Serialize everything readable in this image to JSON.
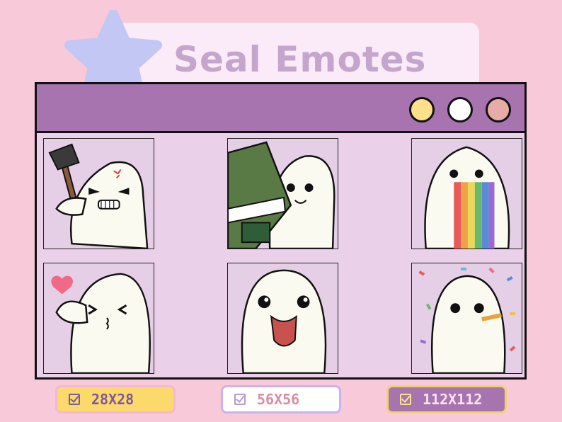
{
  "header": {
    "title": "Seal Emotes"
  },
  "window": {
    "dot_colors": [
      "#fce08a",
      "#ffffff",
      "#e8aca8"
    ]
  },
  "emotes": [
    {
      "name": "axe-angry"
    },
    {
      "name": "money-stack"
    },
    {
      "name": "rainbow-vomit"
    },
    {
      "name": "finger-heart"
    },
    {
      "name": "tongue-out"
    },
    {
      "name": "confetti-party"
    }
  ],
  "sizes": [
    {
      "label": "28X28",
      "bg": "#fcd96b",
      "fg": "#7f5a9a"
    },
    {
      "label": "56X56",
      "bg": "#ffffff",
      "fg": "#d98ea0"
    },
    {
      "label": "112X112",
      "bg": "#a774b0",
      "fg": "#fce3ef"
    }
  ]
}
